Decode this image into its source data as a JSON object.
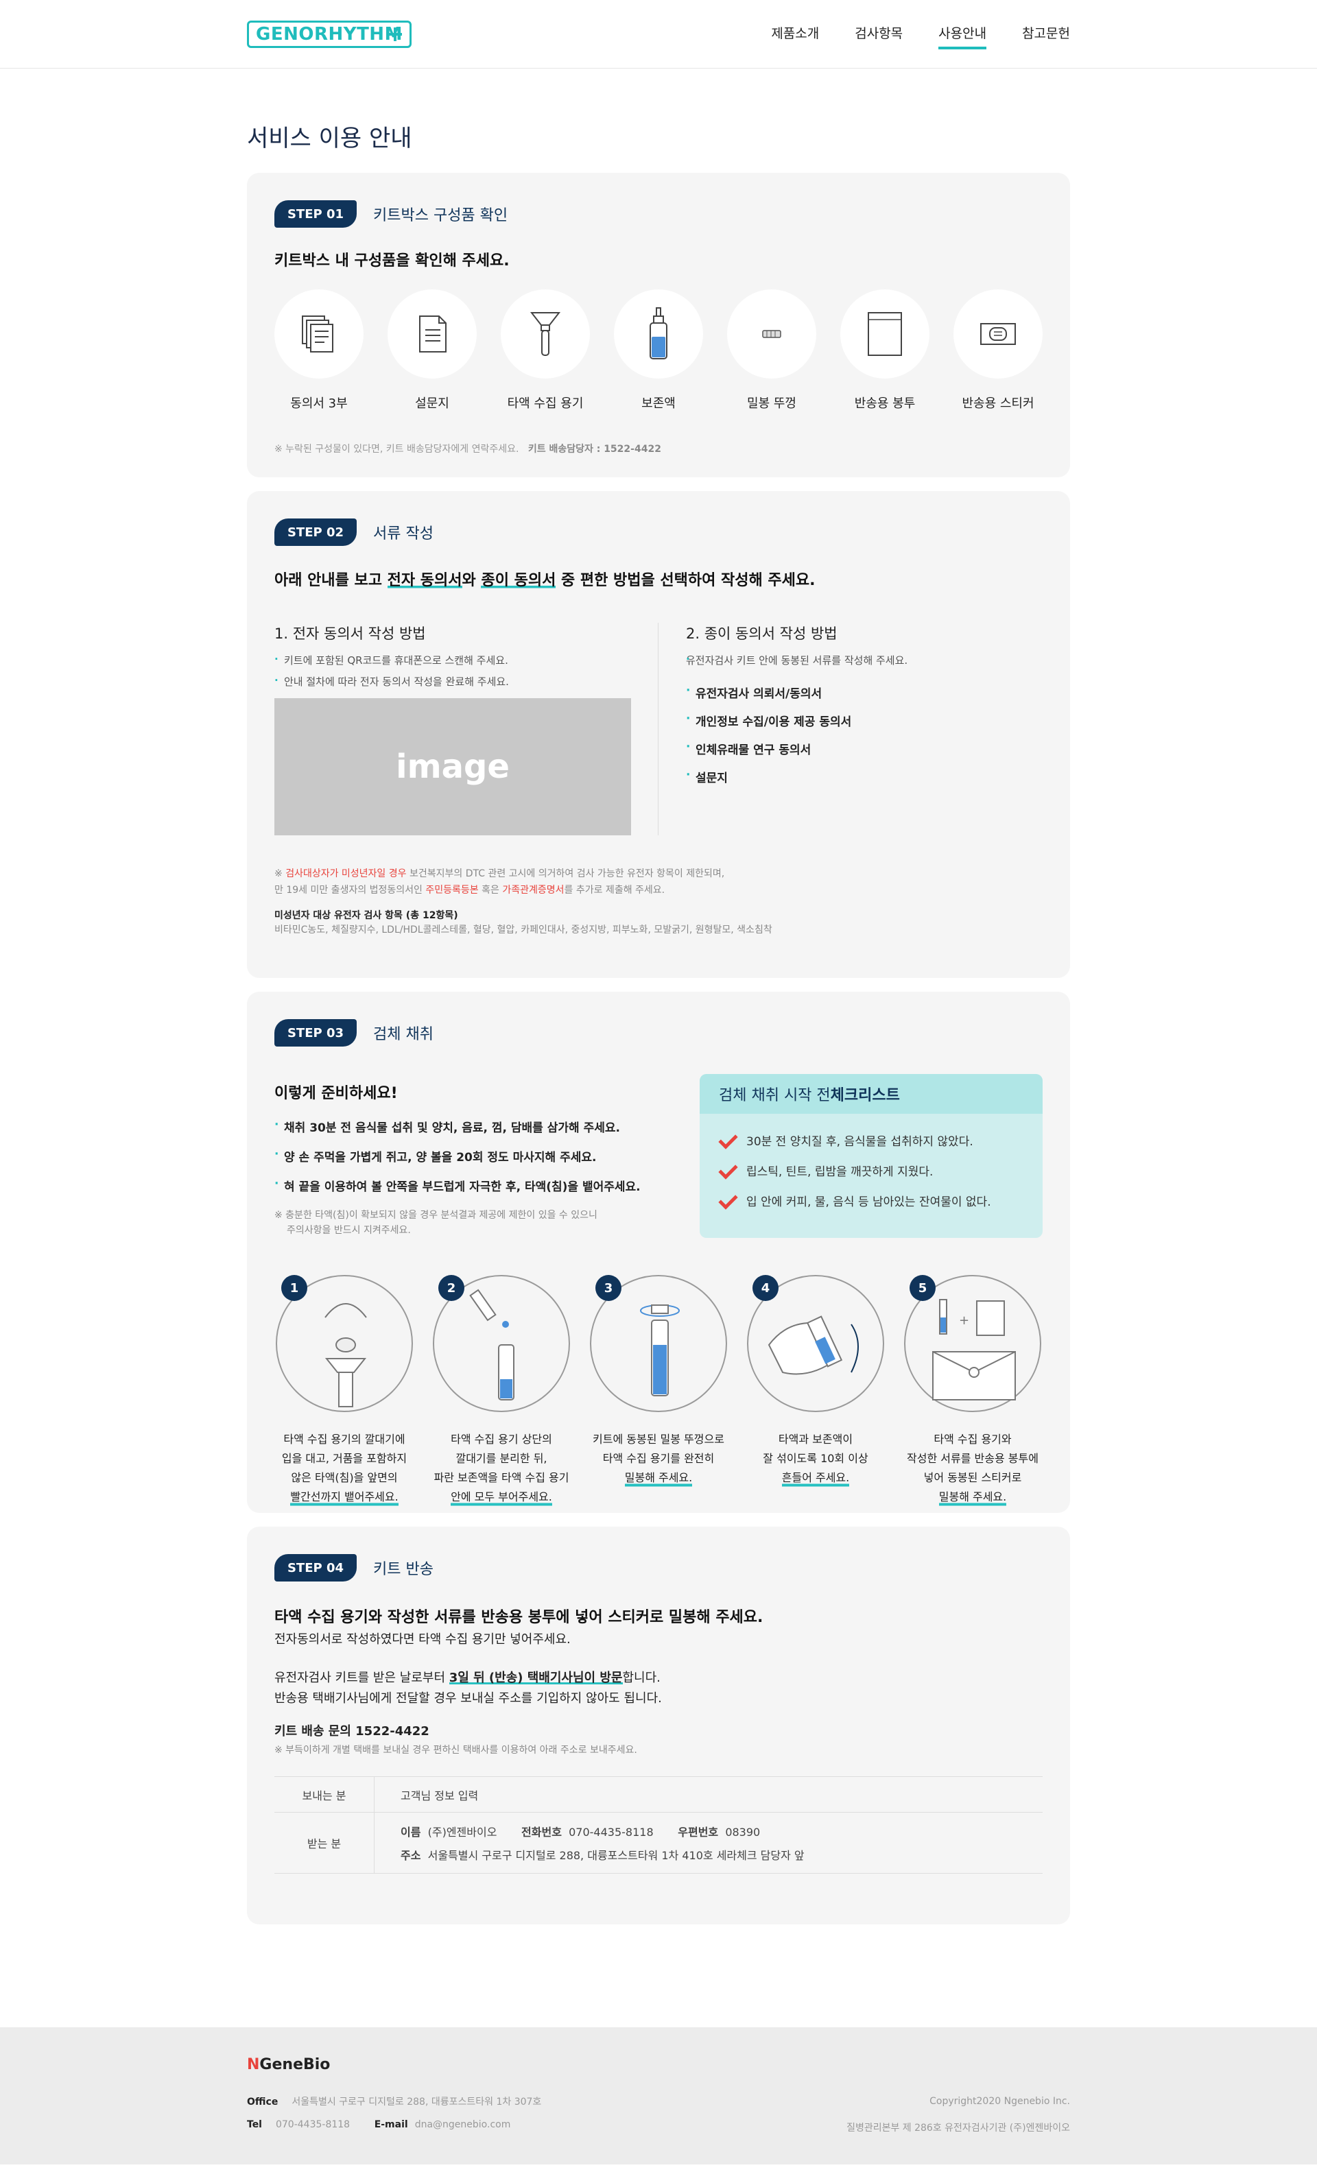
{
  "header": {
    "logo_text": "GENORHYTHM",
    "nav": [
      "제품소개",
      "검사항목",
      "사용안내",
      "참고문헌"
    ],
    "active_nav": "사용안내"
  },
  "page_title": "서비스 이용 안내",
  "step1": {
    "badge": "STEP 01",
    "title": "키트박스 구성품 확인",
    "lead": "키트박스 내 구성품을 확인해 주세요.",
    "items": [
      {
        "label": "동의서 3부",
        "icon": "documents-icon"
      },
      {
        "label": "설문지",
        "icon": "survey-icon"
      },
      {
        "label": "타액 수집 용기",
        "icon": "funnel-tube-icon"
      },
      {
        "label": "보존액",
        "icon": "preservative-bottle-icon"
      },
      {
        "label": "밀봉 뚜껑",
        "icon": "cap-icon"
      },
      {
        "label": "반송용 봉투",
        "icon": "envelope-icon"
      },
      {
        "label": "반송용 스티커",
        "icon": "sticker-icon"
      }
    ],
    "note": "※ 누락된 구성물이 있다면, 키트 배송담당자에게 연락주세요.",
    "note_contact": "키트 배송담당자 : 1522-4422"
  },
  "step2": {
    "badge": "STEP 02",
    "title": "서류 작성",
    "lead_pre": "아래 안내를 보고 ",
    "lead_u1": "전자 동의서",
    "lead_mid": "와 ",
    "lead_u2": "종이 동의서",
    "lead_post": " 중 편한 방법을 선택하여 작성해 주세요.",
    "left_title": "1. 전자 동의서 작성 방법",
    "left_items": [
      "키트에 포함된 QR코드를 휴대폰으로 스캔해 주세요.",
      "안내 절차에 따라 전자 동의서 작성을 완료해 주세요."
    ],
    "image_label": "image",
    "right_title": "2. 종이 동의서 작성 방법",
    "right_desc": "유전자검사 키트 안에 동봉된 서류를 작성해 주세요.",
    "right_items": [
      "유전자검사 의뢰서/동의서",
      "개인정보 수집/이용 제공 동의서",
      "인체유래물 연구 동의서",
      "설문지"
    ],
    "notice_l1_pre": "※ ",
    "notice_l1_red": "검사대상자가 미성년자일 경우",
    "notice_l1_post": " 보건복지부의 DTC 관련 고시에 의거하여 검사 가능한 유전자 항목이 제한되며,",
    "notice_l2_pre": "만 19세 미만 출생자의 법정동의서인 ",
    "notice_l2_red1": "주민등록등본",
    "notice_l2_mid": " 혹은 ",
    "notice_l2_red2": "가족관계증명서",
    "notice_l2_post": "를 추가로 제출해 주세요.",
    "minor_title": "미성년자 대상 유전자 검사 항목 (총 12항목)",
    "minor_items": "비타민C농도, 체질량지수, LDL/HDL콜레스테롤, 혈당, 혈압, 카페인대사, 중성지방, 피부노화, 모발굵기, 원형탈모, 색소침착"
  },
  "step3": {
    "badge": "STEP 03",
    "title": "검체 채취",
    "prep_title": "이렇게 준비하세요!",
    "prep_items": [
      "채취 30분 전 음식물 섭취 및 양치, 음료, 껌, 담배를 삼가해 주세요.",
      "양 손 주먹을 가볍게 쥐고, 양 볼을 20회 정도 마사지해 주세요.",
      "혀 끝을 이용하여 볼 안쪽을 부드럽게 자극한 후, 타액(침)을 뱉어주세요."
    ],
    "warn_l1": "※ 충분한 타액(침)이 확보되지 않을 경우 분석결과 제공에 제한이 있을 수 있으니",
    "warn_l2": "주의사항을 반드시 지켜주세요.",
    "check_title_pre": "검체 채취 시작 전 ",
    "check_title_bold": "체크리스트",
    "check_items": [
      "30분 전 양치질 후, 음식물을 섭취하지 않았다.",
      "립스틱, 틴트, 립밤을 깨끗하게 지웠다.",
      "입 안에 커피, 물, 음식 등 남아있는 잔여물이 없다."
    ],
    "process": [
      {
        "num": "1",
        "lines": [
          "타액 수집 용기의 깔대기에",
          "입을 대고, 거품을 포함하지",
          "않은 타액(침)을 앞면의",
          "빨간선까지 뱉어주세요."
        ]
      },
      {
        "num": "2",
        "lines": [
          "타액 수집 용기 상단의",
          "깔대기를 분리한 뒤,",
          "파란 보존액을 타액 수집 용기",
          "안에 모두 부어주세요."
        ]
      },
      {
        "num": "3",
        "lines": [
          "키트에 동봉된 밀봉 뚜껑으로",
          "타액 수집 용기를 완전히",
          "밀봉해 주세요."
        ]
      },
      {
        "num": "4",
        "lines": [
          "타액과 보존액이",
          "잘 섞이도록 10회 이상",
          "흔들어 주세요."
        ]
      },
      {
        "num": "5",
        "lines": [
          "타액 수집 용기와",
          "작성한 서류를 반송용 봉투에",
          "넣어 동봉된 스티커로",
          "밀봉해 주세요."
        ]
      }
    ]
  },
  "step4": {
    "badge": "STEP 04",
    "title": "키트 반송",
    "lead": "타액 수집 용기와 작성한 서류를 반송용 봉투에 넣어 스티커로 밀봉해 주세요.",
    "sub": "전자동의서로 작성하였다면 타액 수집 용기만 넣어주세요.",
    "line1_pre": "유전자검사 키트를 받은 날로부터 ",
    "line1_u": "3일 뒤 (반송) 택배기사님이 방문",
    "line1_post": "합니다.",
    "line2": "반송용 택배기사님에게 전달할 경우 보내실 주소를 기입하지 않아도 됩니다.",
    "contact": "키트 배송 문의  1522-4422",
    "red_note": "※ 부득이하게 개별 택배를 보내실 경우 편하신 택배사를 이용하여 아래 주소로 보내주세요.",
    "sender_label": "보내는 분",
    "sender_val": "고객님 정보 입력",
    "receiver_label": "받는 분",
    "name_label": "이름",
    "name_val": "(주)엔젠바이오",
    "phone_label": "전화번호",
    "phone_val": "070-4435-8118",
    "zip_label": "우편번호",
    "zip_val": "08390",
    "addr_label": "주소",
    "addr_val": "서울특별시 구로구 디지털로 288, 대륭포스트타워 1차 410호 세라체크 담당자 앞"
  },
  "footer": {
    "logo_n": "N",
    "logo_rest": "GeneBio",
    "office_label": "Office",
    "office_val": "서울특별시 구로구 디지털로 288, 대륭포스트타워 1차 307호",
    "tel_label": "Tel",
    "tel_val": "070-4435-8118",
    "email_label": "E-mail",
    "email_val": "dna@ngenebio.com",
    "copyright": "Copyright2020 Ngenebio Inc.",
    "registration": "질병관리본부 제 286호 유전자검사기관 (주)엔젠바이오"
  }
}
